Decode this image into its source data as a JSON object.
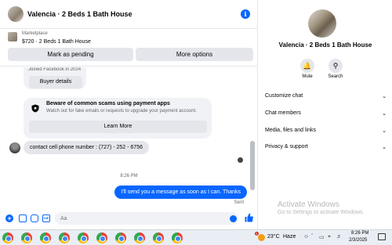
{
  "chat": {
    "title": "Valencia · 2 Beds 1 Bath House",
    "info_icon": "info-icon"
  },
  "listing": {
    "category": "Marketplace",
    "title": "$720 · 2 Beds 1 Bath House",
    "pending_label": "Mark as pending",
    "more_label": "More options"
  },
  "messages": {
    "joined_text": "Joined Facebook in 2024",
    "buyer_details_label": "Buyer details",
    "scam_title": "Beware of common scams using payment apps",
    "scam_subtitle": "Watch out for fake emails or requests to upgrade your payment account.",
    "learn_more_label": "Learn More",
    "incoming": "contact cell phone number : (727) - 252 - 6756",
    "timestamp": "8:26 PM",
    "outgoing": "I'll send you a message as soon as I can. Thanks",
    "status": "Sent"
  },
  "composer": {
    "placeholder": "Aa",
    "icons": [
      "plus-icon",
      "photo-icon",
      "sticker-icon",
      "gif-icon",
      "emoji-icon",
      "like-icon"
    ]
  },
  "details": {
    "title": "Valencia · 2 Beds 1 Bath House",
    "mute_label": "Mute",
    "search_label": "Search",
    "rows": [
      "Customize chat",
      "Chat members",
      "Media, files and links",
      "Privacy & support"
    ]
  },
  "watermark": {
    "line1": "Activate Windows",
    "line2": "Go to Settings to activate Windows."
  },
  "taskbar": {
    "weather_badge": "1",
    "temperature": "23°C",
    "condition": "Haze",
    "time": "8:26 PM",
    "date": "2/3/2025"
  },
  "colors": {
    "accent": "#0866ff",
    "bubble_in": "#e4e6eb",
    "button_bg": "#e4e6eb"
  }
}
